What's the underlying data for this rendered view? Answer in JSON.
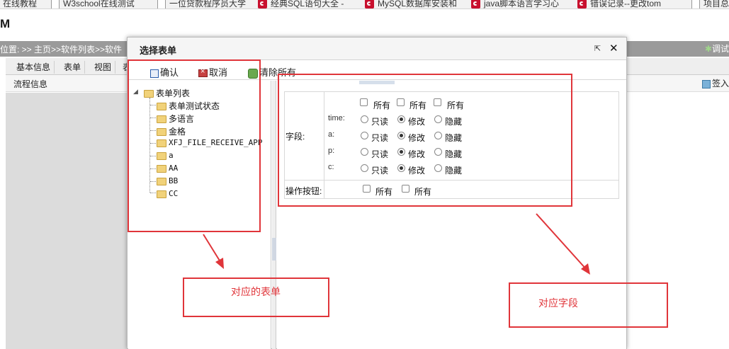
{
  "bookmarks": [
    {
      "label": "在线教程",
      "icon": "doc-icon"
    },
    {
      "label": "W3school在线测试",
      "icon": "doc-icon"
    },
    {
      "label": "一位贷款程序员大学",
      "icon": "doc-icon"
    },
    {
      "label": "经典SQL语句大全 -",
      "icon": "csdn-icon"
    },
    {
      "label": "MySQL数据库安装和",
      "icon": "csdn-icon"
    },
    {
      "label": "java脚本语言学习心",
      "icon": "csdn-icon"
    },
    {
      "label": "错误记录--更改tom",
      "icon": "csdn-icon"
    },
    {
      "label": "项目总",
      "icon": "doc-icon"
    }
  ],
  "app": {
    "title": "M"
  },
  "breadcrumb": "位置: >> 主页>>软件列表>>软件",
  "debug_label": "调试",
  "tabs": [
    "基本信息",
    "表单",
    "视图",
    "表"
  ],
  "flow_label": "流程信息",
  "signin_label": "签入",
  "dialog": {
    "title": "选择表单",
    "toolbar": {
      "confirm": "确认",
      "cancel": "取消",
      "clear_all": "清除所有"
    },
    "tree": {
      "root": "表单列表",
      "items": [
        "表单测试状态",
        "多语言",
        "金格",
        "XFJ_FILE_RECEIVE_APP",
        "a",
        "AA",
        "BB",
        "CC"
      ]
    },
    "fields": {
      "row_label": "字段:",
      "all_label": "所有",
      "options": [
        "只读",
        "修改",
        "隐藏"
      ],
      "names": [
        "time:",
        "a:",
        "p:",
        "c:"
      ],
      "selected_option": "修改",
      "buttons_row_label": "操作按钮:"
    }
  },
  "annotations": {
    "form_label": "对应的表单",
    "field_label": "对应字段",
    "color": "#e0353a"
  }
}
